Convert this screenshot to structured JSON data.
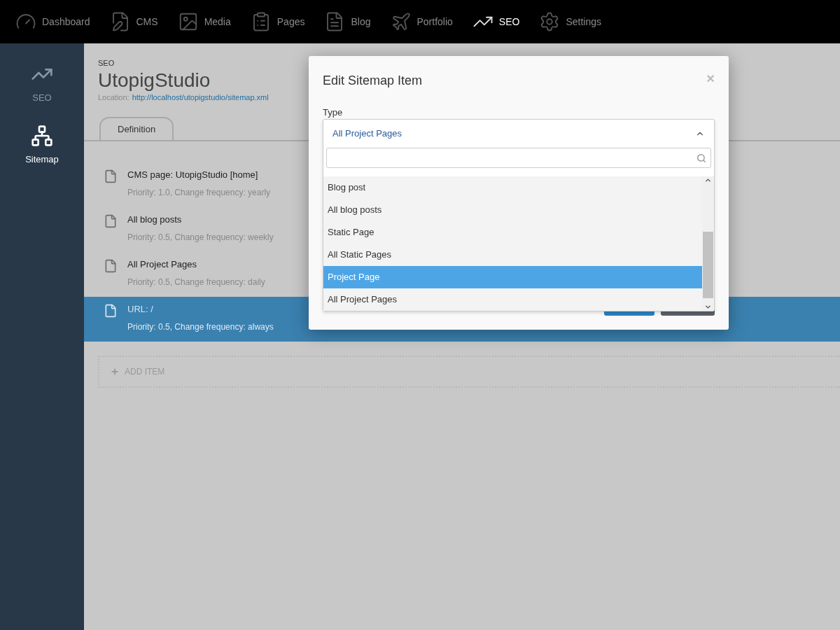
{
  "nav": [
    {
      "label": "Dashboard",
      "selected": false
    },
    {
      "label": "CMS",
      "selected": false
    },
    {
      "label": "Media",
      "selected": false
    },
    {
      "label": "Pages",
      "selected": false
    },
    {
      "label": "Blog",
      "selected": false
    },
    {
      "label": "Portfolio",
      "selected": false
    },
    {
      "label": "SEO",
      "selected": true
    },
    {
      "label": "Settings",
      "selected": false
    }
  ],
  "sidebar": [
    {
      "label": "SEO",
      "selected": false,
      "kind": "chart"
    },
    {
      "label": "Sitemap",
      "selected": true,
      "kind": "sitemap"
    }
  ],
  "page": {
    "breadcrumb": "SEO",
    "title": "UtopigStudio",
    "location_label": "Location:",
    "location_url": "http://localhost/utopigstudio/sitemap.xml"
  },
  "tabs": [
    {
      "label": "Definition",
      "selected": true
    }
  ],
  "items": [
    {
      "title": "CMS page: UtopigStudio [home]",
      "details": "Priority: 1.0, Change frequency: yearly",
      "selected": false
    },
    {
      "title": "All blog posts",
      "details": "Priority: 0.5, Change frequency: weekly",
      "selected": false
    },
    {
      "title": "All Project Pages",
      "details": "Priority: 0.5, Change frequency: daily",
      "selected": false
    },
    {
      "title": "URL: /",
      "details": "Priority: 0.5, Change frequency: always",
      "selected": true
    }
  ],
  "add_item": "ADD ITEM",
  "modal": {
    "title": "Edit Sitemap Item",
    "close": "×",
    "type_label": "Type",
    "select_value": "All Project Pages",
    "options": [
      {
        "label": "Blog post",
        "selected": false
      },
      {
        "label": "All blog posts",
        "selected": false
      },
      {
        "label": "Static Page",
        "selected": false
      },
      {
        "label": "All Static Pages",
        "selected": false
      },
      {
        "label": "Project Page",
        "selected": true
      },
      {
        "label": "All Project Pages",
        "selected": false
      }
    ]
  }
}
